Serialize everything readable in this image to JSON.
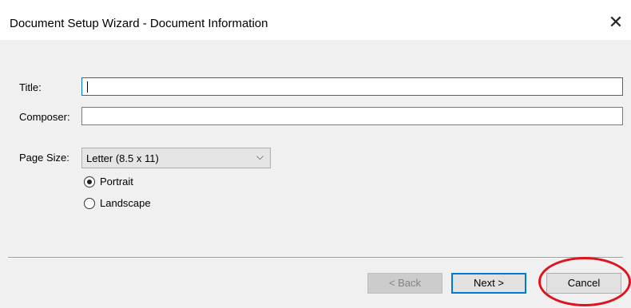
{
  "window": {
    "title": "Document Setup Wizard - Document Information",
    "close_glyph": "✕"
  },
  "form": {
    "title_label": "Title:",
    "title_value": "",
    "composer_label": "Composer:",
    "composer_value": "",
    "page_size_label": "Page Size:",
    "page_size_value": "Letter (8.5 x 11)",
    "chevron_glyph": "⌵",
    "orientation": {
      "options": [
        "Portrait",
        "Landscape"
      ],
      "selected": "Portrait"
    }
  },
  "buttons": {
    "back_label": "< Back",
    "next_label": "Next >",
    "cancel_label": "Cancel"
  },
  "colors": {
    "focus_blue": "#0078d7",
    "annotation_red": "#e0141e"
  }
}
